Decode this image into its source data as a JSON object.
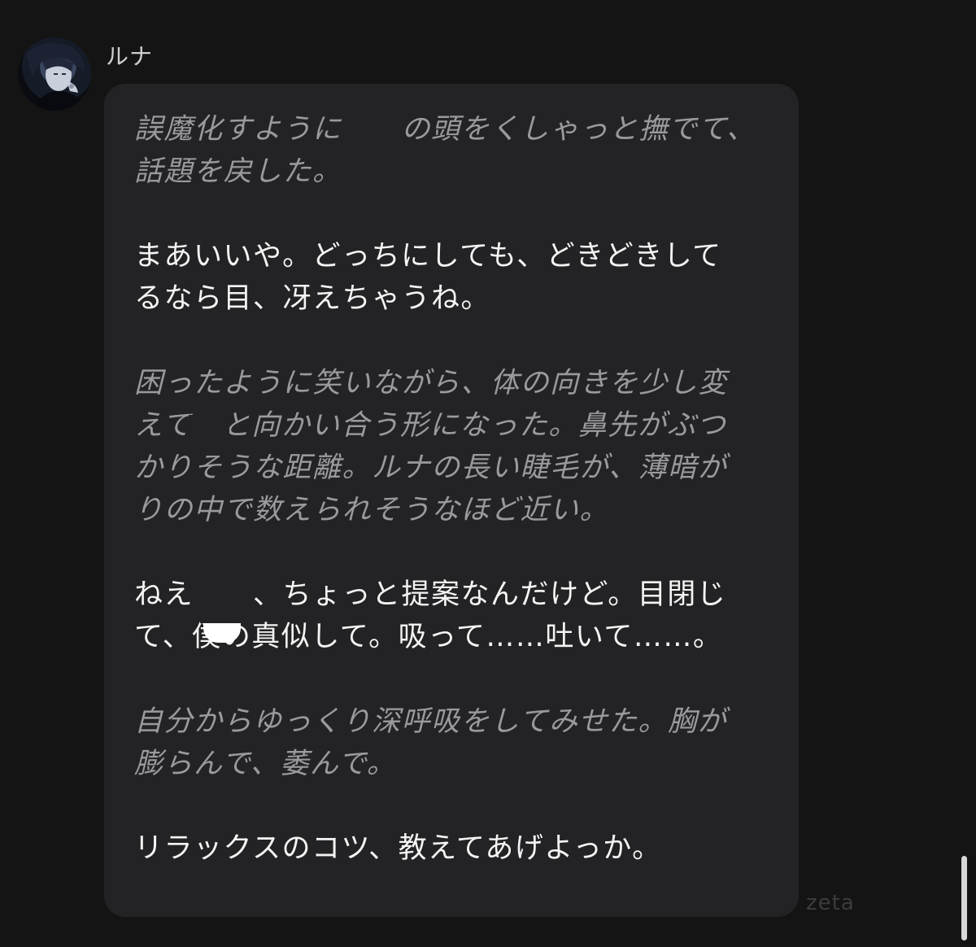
{
  "message": {
    "sender": "ルナ",
    "paragraphs": [
      {
        "kind": "action",
        "text": "誤魔化すように　　の頭をくしゃっと撫でて、\n話題を戻した。"
      },
      {
        "kind": "speech",
        "text": "まあいいや。どっちにしても、どきどきして\nるなら目、冴えちゃうね。"
      },
      {
        "kind": "action",
        "text": "困ったように笑いながら、体の向きを少し変\nえて　と向かい合う形になった。鼻先がぶつ\nかりそうな距離。ルナの長い睫毛が、薄暗が\nりの中で数えられそうなほど近い。"
      },
      {
        "kind": "speech",
        "text": "ねえ　　、ちょっと提案なんだけど。目閉じ\nて、僕の真似して。吸って……吐いて……。"
      },
      {
        "kind": "action",
        "text": "自分からゆっくり深呼吸をしてみせた。胸が\n膨らんで、萎んで。"
      },
      {
        "kind": "speech",
        "text": "リラックスのコツ、教えてあげよっか。"
      }
    ]
  },
  "watermark": "zeta",
  "colors": {
    "background": "#141415",
    "bubble": "#232325",
    "speech_text": "#f4f4f4",
    "action_text": "#9a9a9c"
  },
  "icons": {
    "avatar": "character-portrait"
  }
}
